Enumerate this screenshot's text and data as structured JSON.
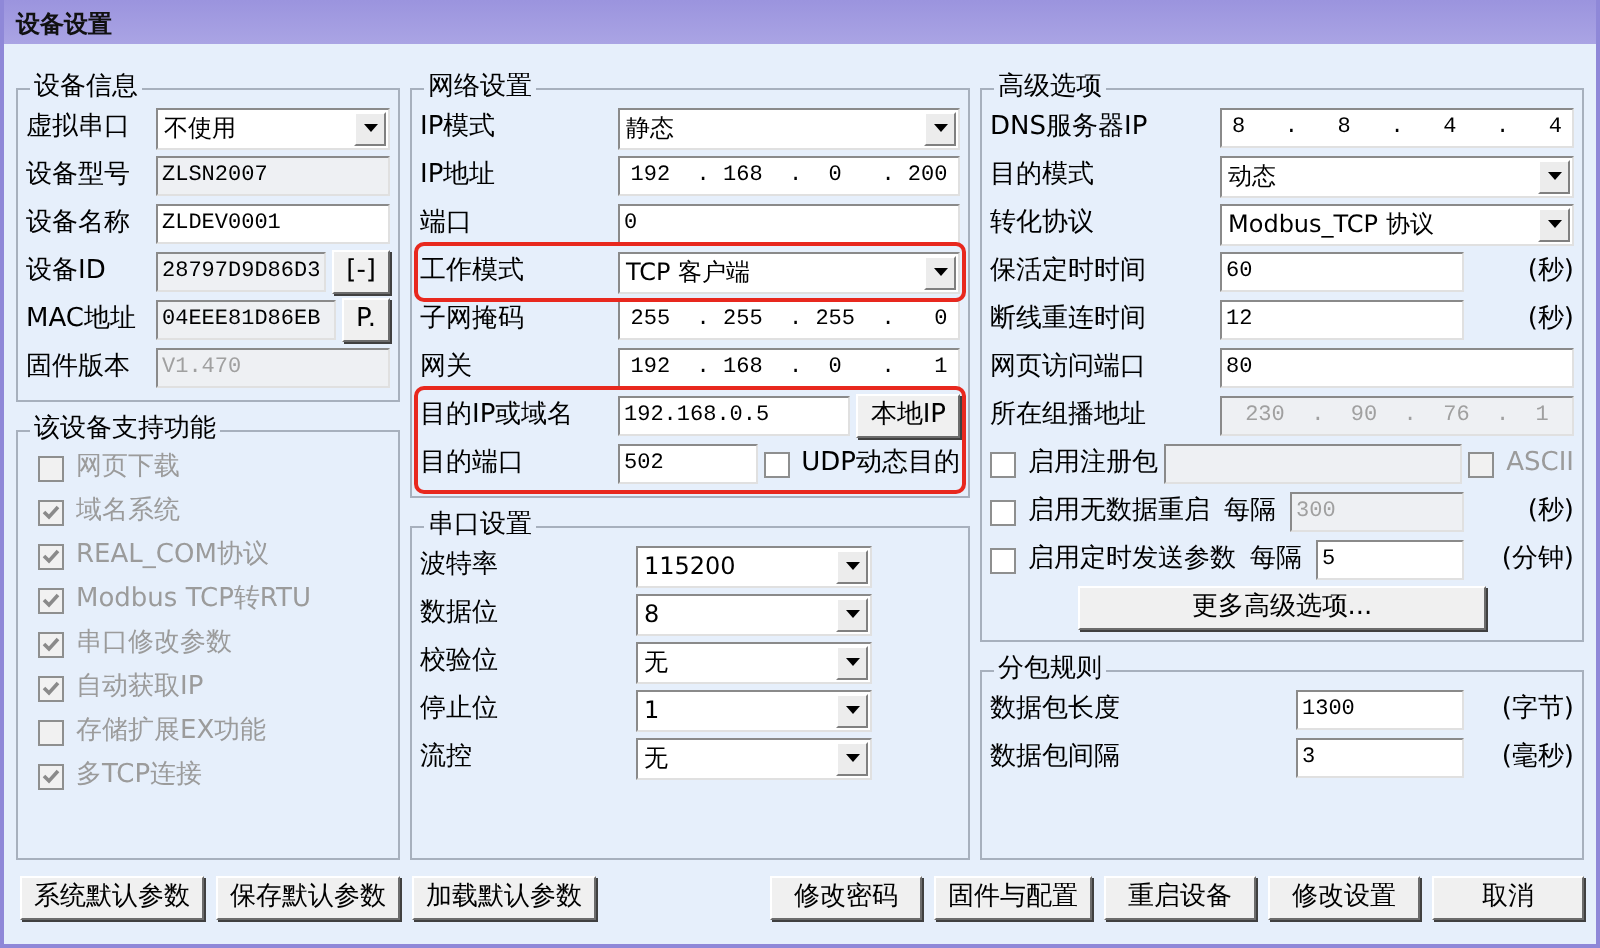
{
  "window": {
    "title": "设备设置"
  },
  "device_info": {
    "legend": "设备信息",
    "rows": [
      {
        "items": [
          {
            "kind": "label",
            "text": "虚拟串口"
          },
          {
            "kind": "select",
            "value": "不使用",
            "disabled": false
          }
        ]
      },
      {
        "items": [
          {
            "kind": "label",
            "text": "设备型号"
          },
          {
            "kind": "text",
            "value": "ZLSN2007",
            "readonly": true,
            "disabled": false
          }
        ]
      },
      {
        "items": [
          {
            "kind": "label",
            "text": "设备名称"
          },
          {
            "kind": "text",
            "value": "ZLDEV0001",
            "readonly": false,
            "disabled": false
          }
        ]
      },
      {
        "items": [
          {
            "kind": "label",
            "text": "设备ID"
          },
          {
            "kind": "text",
            "value": "28797D9D86D3",
            "readonly": true,
            "disabled": false
          },
          {
            "kind": "button",
            "text": "[-]"
          }
        ]
      },
      {
        "items": [
          {
            "kind": "label",
            "text": "MAC地址"
          },
          {
            "kind": "text",
            "value": "04EEE81D86EB",
            "readonly": true,
            "disabled": false
          },
          {
            "kind": "button",
            "text": "P."
          }
        ]
      },
      {
        "items": [
          {
            "kind": "label",
            "text": "固件版本"
          },
          {
            "kind": "text",
            "value": "V1.470",
            "readonly": true,
            "disabled": true
          }
        ]
      }
    ]
  },
  "features": {
    "legend": "该设备支持功能",
    "rows": [
      {
        "items": [
          {
            "kind": "check",
            "label": "网页下载",
            "checked": false,
            "disabled": true
          }
        ]
      },
      {
        "items": [
          {
            "kind": "check",
            "label": "域名系统",
            "checked": true,
            "disabled": true
          }
        ]
      },
      {
        "items": [
          {
            "kind": "check",
            "label": "REAL_COM协议",
            "checked": true,
            "disabled": true
          }
        ]
      },
      {
        "items": [
          {
            "kind": "check",
            "label": "Modbus TCP转RTU",
            "checked": true,
            "disabled": true
          }
        ]
      },
      {
        "items": [
          {
            "kind": "check",
            "label": "串口修改参数",
            "checked": true,
            "disabled": true
          }
        ]
      },
      {
        "items": [
          {
            "kind": "check",
            "label": "自动获取IP",
            "checked": true,
            "disabled": true
          }
        ]
      },
      {
        "items": [
          {
            "kind": "check",
            "label": "存储扩展EX功能",
            "checked": false,
            "disabled": true
          }
        ]
      },
      {
        "items": [
          {
            "kind": "check",
            "label": "多TCP连接",
            "checked": true,
            "disabled": true
          }
        ]
      }
    ]
  },
  "network": {
    "legend": "网络设置",
    "groups": [
      {
        "highlighted": false,
        "rows": [
          {
            "items": [
              {
                "kind": "label",
                "text": "IP模式"
              },
              {
                "kind": "select",
                "value": "静态",
                "disabled": false
              }
            ]
          },
          {
            "items": [
              {
                "kind": "label",
                "text": "IP地址"
              },
              {
                "kind": "ip",
                "value": "192  . 168  .  0   . 200",
                "readonly": false,
                "disabled": false
              }
            ]
          },
          {
            "items": [
              {
                "kind": "label",
                "text": "端口"
              },
              {
                "kind": "text",
                "value": "0",
                "readonly": false,
                "disabled": false
              }
            ]
          }
        ]
      },
      {
        "highlighted": true,
        "rows": [
          {
            "items": [
              {
                "kind": "label",
                "text": "工作模式"
              },
              {
                "kind": "select",
                "value": "TCP 客户端",
                "disabled": false
              }
            ]
          }
        ]
      },
      {
        "highlighted": false,
        "rows": [
          {
            "items": [
              {
                "kind": "label",
                "text": "子网掩码"
              },
              {
                "kind": "ip",
                "value": "255  . 255  . 255  .   0",
                "readonly": false,
                "disabled": false
              }
            ]
          },
          {
            "items": [
              {
                "kind": "label",
                "text": "网关"
              },
              {
                "kind": "ip",
                "value": "192  . 168  .  0   .   1",
                "readonly": false,
                "disabled": false
              }
            ]
          }
        ]
      },
      {
        "highlighted": true,
        "rows": [
          {
            "items": [
              {
                "kind": "label",
                "text": "目的IP或域名"
              },
              {
                "kind": "text",
                "value": "192.168.0.5",
                "readonly": false,
                "disabled": false
              },
              {
                "kind": "button",
                "text": "本地IP"
              }
            ]
          },
          {
            "items": [
              {
                "kind": "label",
                "text": "目的端口"
              },
              {
                "kind": "text",
                "value": "502",
                "readonly": false,
                "disabled": false
              },
              {
                "kind": "check",
                "label": "UDP动态目的",
                "checked": false,
                "disabled": false
              }
            ]
          }
        ]
      }
    ]
  },
  "serial": {
    "legend": "串口设置",
    "rows": [
      {
        "items": [
          {
            "kind": "label",
            "text": "波特率"
          },
          {
            "kind": "select",
            "value": "115200",
            "disabled": false
          }
        ]
      },
      {
        "items": [
          {
            "kind": "label",
            "text": "数据位"
          },
          {
            "kind": "select",
            "value": "8",
            "disabled": false
          }
        ]
      },
      {
        "items": [
          {
            "kind": "label",
            "text": "校验位"
          },
          {
            "kind": "select",
            "value": "无",
            "disabled": false
          }
        ]
      },
      {
        "items": [
          {
            "kind": "label",
            "text": "停止位"
          },
          {
            "kind": "select",
            "value": "1",
            "disabled": false
          }
        ]
      },
      {
        "items": [
          {
            "kind": "label",
            "text": "流控"
          },
          {
            "kind": "select",
            "value": "无",
            "disabled": false
          }
        ]
      }
    ]
  },
  "advanced": {
    "legend": "高级选项",
    "rows": [
      {
        "items": [
          {
            "kind": "label",
            "text": "DNS服务器IP"
          },
          {
            "kind": "ip",
            "value": "8   .   8   .   4   .   4",
            "readonly": false,
            "disabled": false
          }
        ]
      },
      {
        "items": [
          {
            "kind": "label",
            "text": "目的模式"
          },
          {
            "kind": "select",
            "value": "动态",
            "disabled": false
          }
        ]
      },
      {
        "items": [
          {
            "kind": "label",
            "text": "转化协议"
          },
          {
            "kind": "select",
            "value": "Modbus_TCP 协议",
            "disabled": false
          }
        ]
      },
      {
        "items": [
          {
            "kind": "label",
            "text": "保活定时时间"
          },
          {
            "kind": "text",
            "value": "60",
            "readonly": false,
            "disabled": false
          },
          {
            "kind": "unit",
            "text": "(秒)"
          }
        ]
      },
      {
        "items": [
          {
            "kind": "label",
            "text": "断线重连时间"
          },
          {
            "kind": "text",
            "value": "12",
            "readonly": false,
            "disabled": false
          },
          {
            "kind": "unit",
            "text": "(秒)"
          }
        ]
      },
      {
        "items": [
          {
            "kind": "label",
            "text": "网页访问端口"
          },
          {
            "kind": "text",
            "value": "80",
            "readonly": false,
            "disabled": false
          }
        ]
      },
      {
        "items": [
          {
            "kind": "label",
            "text": "所在组播地址"
          },
          {
            "kind": "ip",
            "value": "230  .  90  .  76  .  1",
            "readonly": true,
            "disabled": true
          }
        ]
      },
      {
        "items": [
          {
            "kind": "check",
            "label": "启用注册包",
            "checked": false,
            "disabled": false
          },
          {
            "kind": "text",
            "readonly": true,
            "disabled": true
          },
          {
            "kind": "check",
            "label": "ASCII",
            "checked": false,
            "disabled": true
          }
        ]
      },
      {
        "items": [
          {
            "kind": "check",
            "label": "启用无数据重启",
            "checked": false,
            "disabled": false
          },
          {
            "kind": "note",
            "text": "每隔"
          },
          {
            "kind": "text",
            "value": "300",
            "readonly": true,
            "disabled": true
          },
          {
            "kind": "unit",
            "text": "(秒)"
          }
        ]
      },
      {
        "items": [
          {
            "kind": "check",
            "label": "启用定时发送参数",
            "checked": false,
            "disabled": false
          },
          {
            "kind": "note",
            "text": "每隔"
          },
          {
            "kind": "text",
            "value": "5",
            "readonly": false,
            "disabled": false
          },
          {
            "kind": "unit",
            "text": "(分钟)"
          }
        ]
      },
      {
        "items": [
          {
            "kind": "button",
            "text": "更多高级选项..."
          }
        ]
      }
    ]
  },
  "packet": {
    "legend": "分包规则",
    "rows": [
      {
        "items": [
          {
            "kind": "label",
            "text": "数据包长度"
          },
          {
            "kind": "text",
            "value": "1300",
            "readonly": false,
            "disabled": false
          },
          {
            "kind": "unit",
            "text": "(字节)"
          }
        ]
      },
      {
        "items": [
          {
            "kind": "label",
            "text": "数据包间隔"
          },
          {
            "kind": "text",
            "value": "3",
            "readonly": false,
            "disabled": false
          },
          {
            "kind": "unit",
            "text": "(毫秒)"
          }
        ]
      }
    ]
  },
  "buttons_left": [
    "系统默认参数",
    "保存默认参数",
    "加载默认参数"
  ],
  "buttons_right": [
    "修改密码",
    "固件与配置",
    "重启设备",
    "修改设置",
    "取消"
  ]
}
